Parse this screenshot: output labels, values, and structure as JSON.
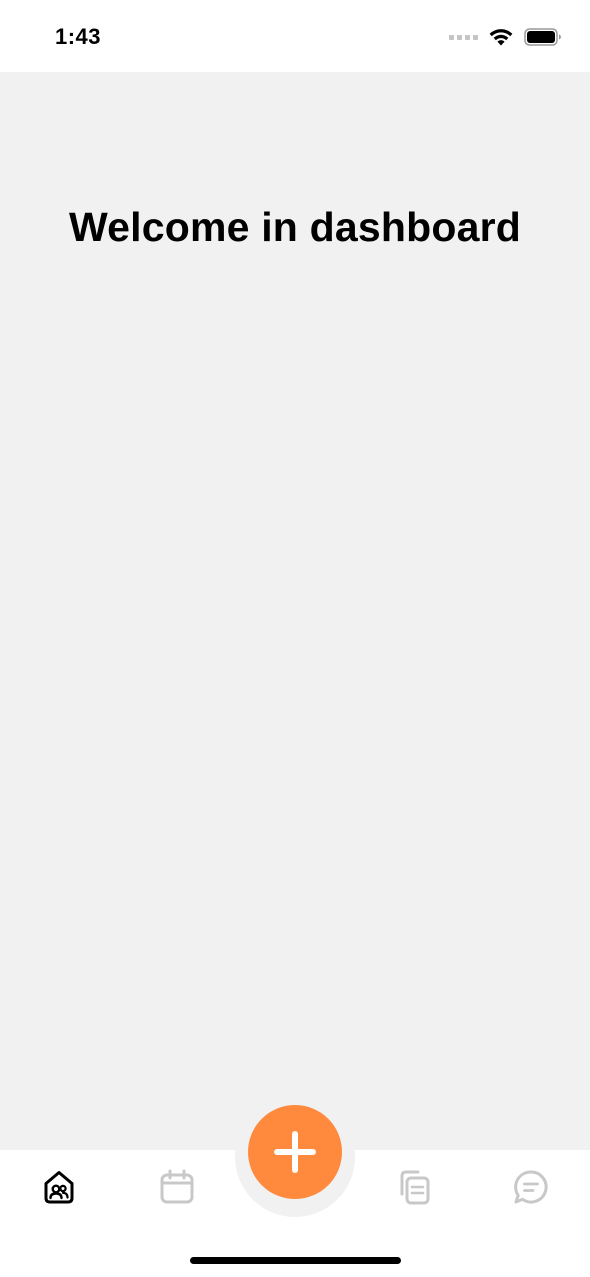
{
  "status_bar": {
    "time": "1:43",
    "icons": [
      "signal-dots-icon",
      "wifi-icon",
      "battery-icon"
    ]
  },
  "main": {
    "title": "Welcome in dashboard"
  },
  "tab_bar": {
    "items": [
      {
        "name": "home",
        "icon": "home-people-icon",
        "active": true
      },
      {
        "name": "calendar",
        "icon": "calendar-icon",
        "active": false
      },
      {
        "name": "documents",
        "icon": "documents-icon",
        "active": false
      },
      {
        "name": "messages",
        "icon": "chat-bubble-icon",
        "active": false
      }
    ],
    "fab_icon": "plus-icon"
  },
  "colors": {
    "accent": "#FF8A3D",
    "background": "#F1F1F1",
    "active_icon": "#000000",
    "inactive_icon": "#C8C8C8"
  }
}
